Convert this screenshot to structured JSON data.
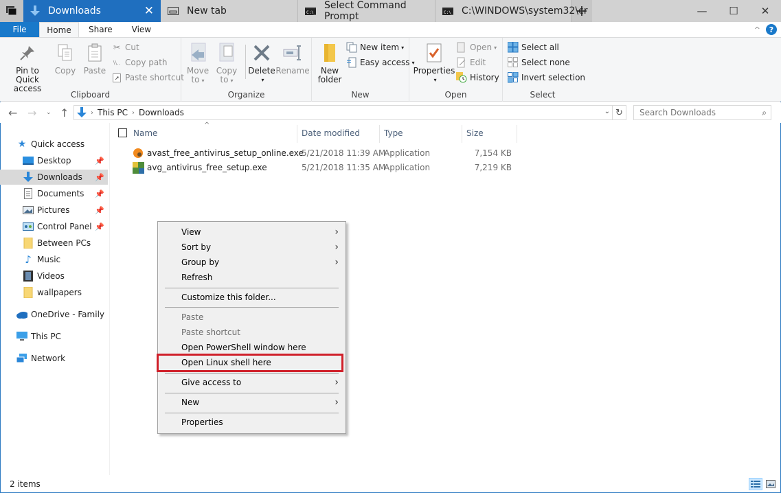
{
  "tabbar": {
    "tabs": [
      {
        "label": "Downloads",
        "icon": "download-arrow-icon",
        "active": true
      },
      {
        "label": "New tab",
        "icon": "new-tab-icon"
      },
      {
        "label": "Select Command Prompt",
        "icon": "cmd-icon"
      },
      {
        "label": "C:\\WINDOWS\\system32\\cr",
        "icon": "cmd-icon"
      }
    ],
    "new_tab": "+",
    "minimize": "—",
    "maximize": "☐",
    "close": "✕"
  },
  "ribbon_tabs": {
    "file": "File",
    "home": "Home",
    "share": "Share",
    "view": "View",
    "collapse": "^",
    "help": "?"
  },
  "ribbon": {
    "clipboard": {
      "label": "Clipboard",
      "pin": "Pin to Quick access",
      "pin_line1": "Pin to Quick",
      "pin_line2": "access",
      "copy": "Copy",
      "paste": "Paste",
      "cut": "Cut",
      "copy_path": "Copy path",
      "paste_shortcut": "Paste shortcut"
    },
    "organize": {
      "label": "Organize",
      "move_to_1": "Move",
      "move_to_2": "to",
      "copy_to_1": "Copy",
      "copy_to_2": "to",
      "delete": "Delete",
      "rename": "Rename"
    },
    "new": {
      "label": "New",
      "new_folder_1": "New",
      "new_folder_2": "folder",
      "new_item": "New item",
      "easy_access": "Easy access"
    },
    "open": {
      "label": "Open",
      "properties": "Properties",
      "open": "Open",
      "edit": "Edit",
      "history": "History"
    },
    "select": {
      "label": "Select",
      "select_all": "Select all",
      "select_none": "Select none",
      "invert_selection": "Invert selection"
    }
  },
  "address": {
    "crumbs": [
      "This PC",
      "Downloads"
    ],
    "search_placeholder": "Search Downloads"
  },
  "sidebar": {
    "items": [
      {
        "label": "Quick access",
        "icon": "star-icon"
      },
      {
        "label": "Desktop",
        "icon": "desktop-icon",
        "pinned": true
      },
      {
        "label": "Downloads",
        "icon": "download-arrow-icon",
        "pinned": true,
        "selected": true
      },
      {
        "label": "Documents",
        "icon": "document-icon",
        "pinned": true
      },
      {
        "label": "Pictures",
        "icon": "pictures-icon",
        "pinned": true
      },
      {
        "label": "Control Panel",
        "icon": "control-panel-icon",
        "pinned": true
      },
      {
        "label": "Between PCs",
        "icon": "folder-icon"
      },
      {
        "label": "Music",
        "icon": "music-icon"
      },
      {
        "label": "Videos",
        "icon": "videos-icon"
      },
      {
        "label": "wallpapers",
        "icon": "folder-icon"
      },
      {
        "label": "OneDrive - Family",
        "icon": "onedrive-icon"
      },
      {
        "label": "This PC",
        "icon": "computer-icon"
      },
      {
        "label": "Network",
        "icon": "network-icon"
      }
    ]
  },
  "filelist": {
    "columns": [
      "Name",
      "Date modified",
      "Type",
      "Size"
    ],
    "rows": [
      {
        "name": "avast_free_antivirus_setup_online.exe",
        "date": "5/21/2018 11:39 AM",
        "type": "Application",
        "size": "7,154 KB",
        "icon": "avast-icon"
      },
      {
        "name": "avg_antivirus_free_setup.exe",
        "date": "5/21/2018 11:35 AM",
        "type": "Application",
        "size": "7,219 KB",
        "icon": "avg-icon"
      }
    ]
  },
  "context_menu": {
    "view": "View",
    "sort_by": "Sort by",
    "group_by": "Group by",
    "refresh": "Refresh",
    "customize": "Customize this folder...",
    "paste": "Paste",
    "paste_shortcut": "Paste shortcut",
    "open_powershell": "Open PowerShell window here",
    "open_linux": "Open Linux shell here",
    "give_access": "Give access to",
    "new": "New",
    "properties": "Properties",
    "highlight_color": "#d0202a"
  },
  "status": {
    "count": "2 items"
  },
  "colors": {
    "accent": "#1979ca",
    "active_tab": "#1f6fbf",
    "ribbon_bg": "#f5f6f7",
    "highlight": "#d0202a"
  }
}
